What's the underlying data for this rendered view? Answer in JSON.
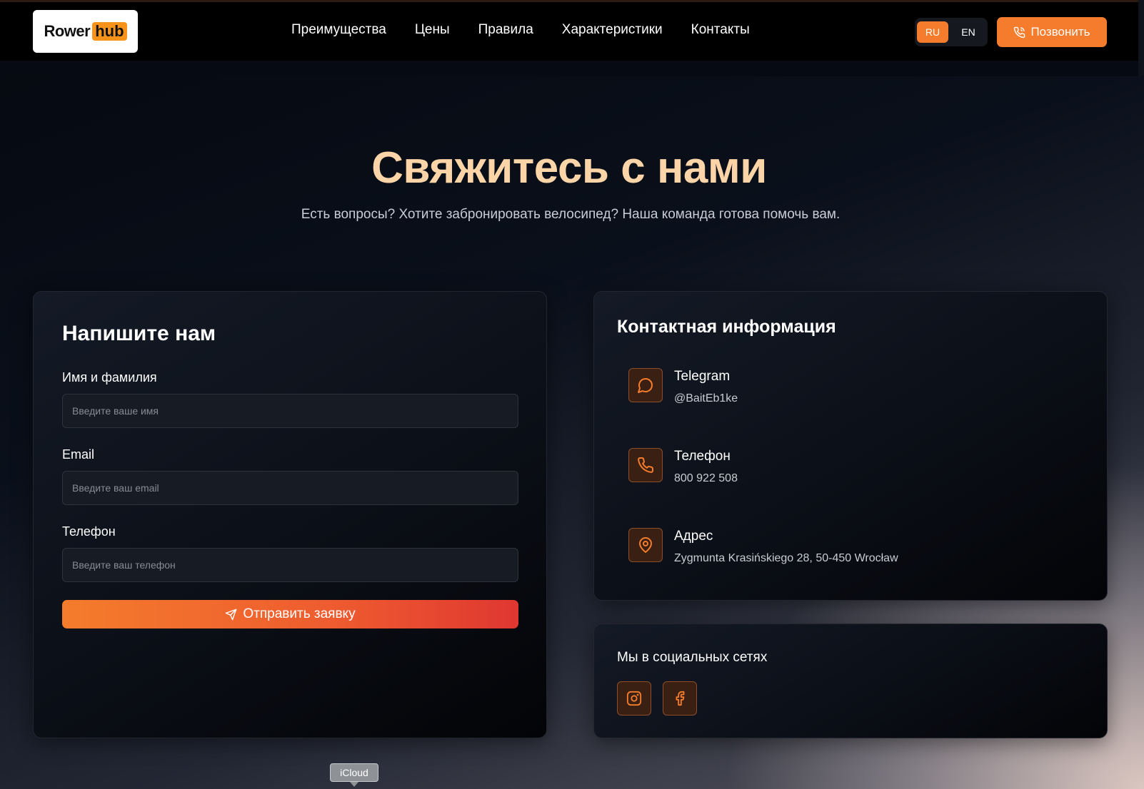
{
  "brand": {
    "logo_text": "Rower",
    "logo_hub": "hub",
    "accent": "#f47c2c",
    "title_color": "#fbd4a8"
  },
  "nav": {
    "items": [
      "Преимущества",
      "Цены",
      "Правила",
      "Характеристики",
      "Контакты"
    ]
  },
  "lang": {
    "active": "RU",
    "other": "EN"
  },
  "call_button": {
    "label": "Позвонить",
    "icon": "phone-icon"
  },
  "hero": {
    "title": "Свяжитесь с нами",
    "subtitle": "Есть вопросы? Хотите забронировать велосипед? Наша команда готова помочь вам."
  },
  "form": {
    "title": "Напишите нам",
    "name_label": "Имя и фамилия",
    "name_placeholder": "Введите ваше имя",
    "email_label": "Email",
    "email_placeholder": "Введите ваш email",
    "phone_label": "Телефон",
    "phone_placeholder": "Введите ваш телефон",
    "submit_label": "Отправить заявку"
  },
  "contact": {
    "title": "Контактная информация",
    "items": [
      {
        "icon": "chat-icon",
        "title": "Telegram",
        "value": "@BaitEb1ke"
      },
      {
        "icon": "phone-icon",
        "title": "Телефон",
        "value": "800 922 508"
      },
      {
        "icon": "map-pin-icon",
        "title": "Адрес",
        "value": "Zygmunta Krasińskiego 28, 50-450 Wrocław"
      }
    ]
  },
  "social": {
    "title": "Мы в социальных сетях",
    "items": [
      {
        "icon": "instagram-icon"
      },
      {
        "icon": "facebook-icon"
      }
    ]
  },
  "tooltip": {
    "text": "iCloud"
  }
}
